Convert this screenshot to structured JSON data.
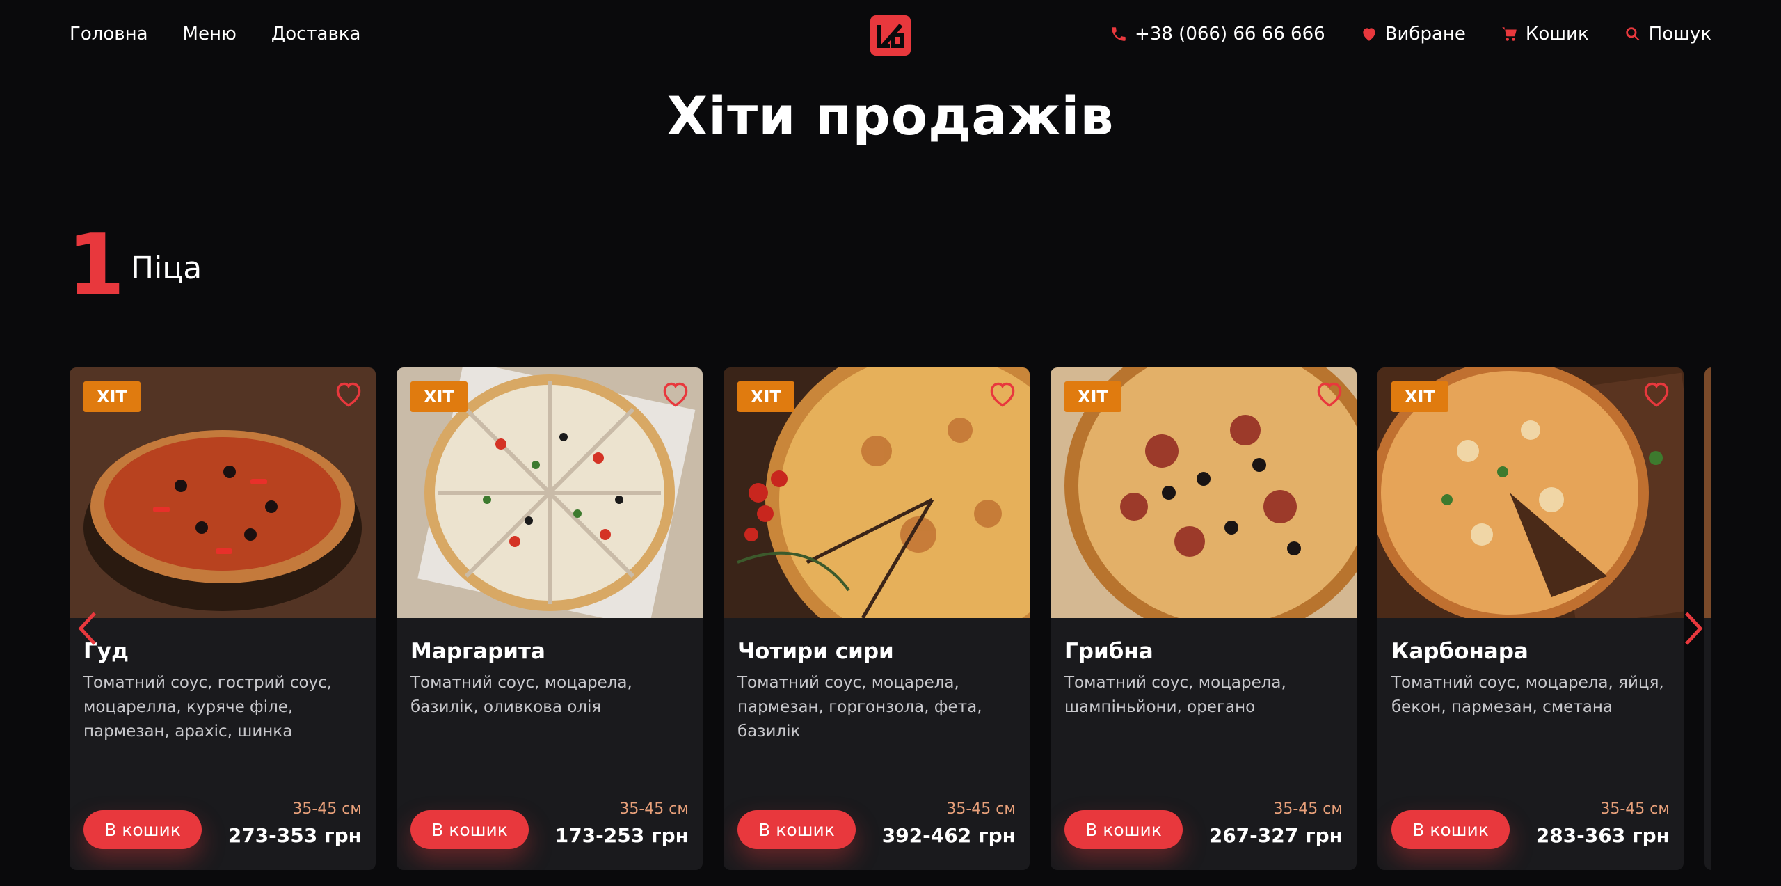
{
  "nav": {
    "left": [
      "Головна",
      "Меню",
      "Доставка"
    ],
    "phone": "+38 (066) 66 66 666",
    "favorites": "Вибране",
    "cart": "Кошик",
    "search": "Пошук"
  },
  "page_title": "Хіти продажів",
  "section": {
    "number": "1",
    "title": "Піца"
  },
  "colors": {
    "accent": "#e8383d",
    "badge": "#e07b0f",
    "size_text": "#e8a07a",
    "background": "#0a0a0c",
    "card": "#1a1a1d"
  },
  "cards": [
    {
      "badge": "ХІТ",
      "title": "Гуд",
      "desc": "Томатний соус, гострий соус, моцарелла, куряче філе, пармезан, арахіс, шинка",
      "size": "35-45 см",
      "price": "273-353 грн",
      "button": "В кошик"
    },
    {
      "badge": "ХІТ",
      "title": "Маргарита",
      "desc": "Томатний соус, моцарела, базилік, оливкова олія",
      "size": "35-45 см",
      "price": "173-253 грн",
      "button": "В кошик"
    },
    {
      "badge": "ХІТ",
      "title": "Чотири сири",
      "desc": "Томатний соус, моцарела, пармезан, горгонзола, фета, базилік",
      "size": "35-45 см",
      "price": "392-462 грн",
      "button": "В кошик"
    },
    {
      "badge": "ХІТ",
      "title": "Грибна",
      "desc": "Томатний соус, моцарела, шампіньйони, орегано",
      "size": "35-45 см",
      "price": "267-327 грн",
      "button": "В кошик"
    },
    {
      "badge": "ХІТ",
      "title": "Карбонара",
      "desc": "Томатний соус, моцарела, яйця, бекон, пармезан, сметана",
      "size": "35-45 см",
      "price": "283-363 грн",
      "button": "В кошик"
    }
  ]
}
